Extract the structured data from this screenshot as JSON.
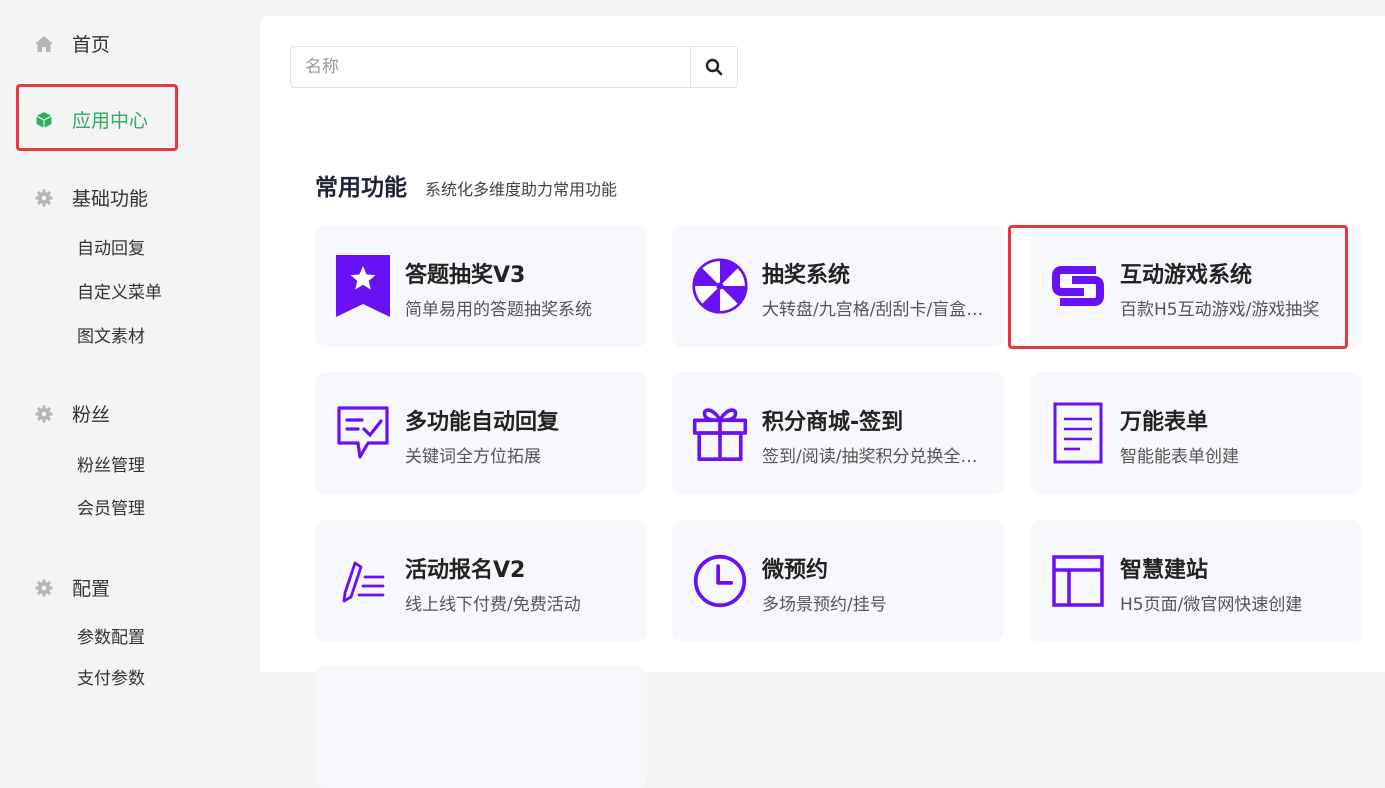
{
  "sidebar": {
    "home": "首页",
    "app_center": "应用中心",
    "basic": {
      "label": "基础功能",
      "items": [
        "自动回复",
        "自定义菜单",
        "图文素材"
      ]
    },
    "fans": {
      "label": "粉丝",
      "items": [
        "粉丝管理",
        "会员管理"
      ]
    },
    "config": {
      "label": "配置",
      "items": [
        "参数配置",
        "支付参数"
      ]
    }
  },
  "search": {
    "placeholder": "名称"
  },
  "section": {
    "title": "常用功能",
    "subtitle": "系统化多维度助力常用功能"
  },
  "cards": [
    {
      "title": "答题抽奖V3",
      "desc": "简单易用的答题抽奖系统",
      "icon": "ribbon-star-icon"
    },
    {
      "title": "抽奖系统",
      "desc": "大转盘/九宫格/刮刮卡/盲盒抽奖",
      "icon": "prize-wheel-icon"
    },
    {
      "title": "互动游戏系统",
      "desc": "百款H5互动游戏/游戏抽奖",
      "icon": "link-icon"
    },
    {
      "title": "多功能自动回复",
      "desc": "关键词全方位拓展",
      "icon": "chat-check-icon"
    },
    {
      "title": "积分商城-签到",
      "desc": "签到/阅读/抽奖积分兑换全场景",
      "icon": "gift-icon"
    },
    {
      "title": "万能表单",
      "desc": "智能能表单创建",
      "icon": "form-icon"
    },
    {
      "title": "活动报名V2",
      "desc": "线上线下付费/免费活动",
      "icon": "pen-list-icon"
    },
    {
      "title": "微预约",
      "desc": "多场景预约/挂号",
      "icon": "clock-icon"
    },
    {
      "title": "智慧建站",
      "desc": "H5页面/微官网快速创建",
      "icon": "layout-icon"
    }
  ],
  "colors": {
    "accent": "#6a10f5",
    "active": "#2fae5a",
    "highlight": "#e8383d"
  }
}
